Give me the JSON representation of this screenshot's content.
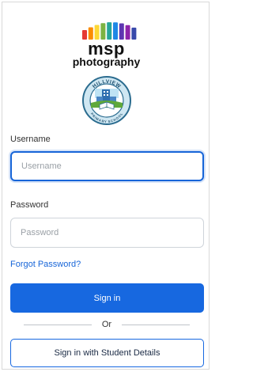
{
  "logo": {
    "brand": "msp",
    "brand_sub": "photography",
    "bar_colors": [
      "#e53935",
      "#fb8c00",
      "#fdd835",
      "#7cb342",
      "#26a69a",
      "#1e88e5",
      "#5e35b1",
      "#8e24aa",
      "#3949ab"
    ]
  },
  "crest": {
    "school_name_top": "HILLVIEW",
    "school_name_bottom": "PRIMARY SCHOOL"
  },
  "form": {
    "username_label": "Username",
    "username_placeholder": "Username",
    "username_value": "",
    "password_label": "Password",
    "password_placeholder": "Password",
    "password_value": "",
    "forgot_password": "Forgot Password?",
    "sign_in": "Sign in",
    "or": "Or",
    "student_sign_in": "Sign in with Student Details"
  },
  "colors": {
    "primary": "#1768e0",
    "link": "#1765d8"
  }
}
